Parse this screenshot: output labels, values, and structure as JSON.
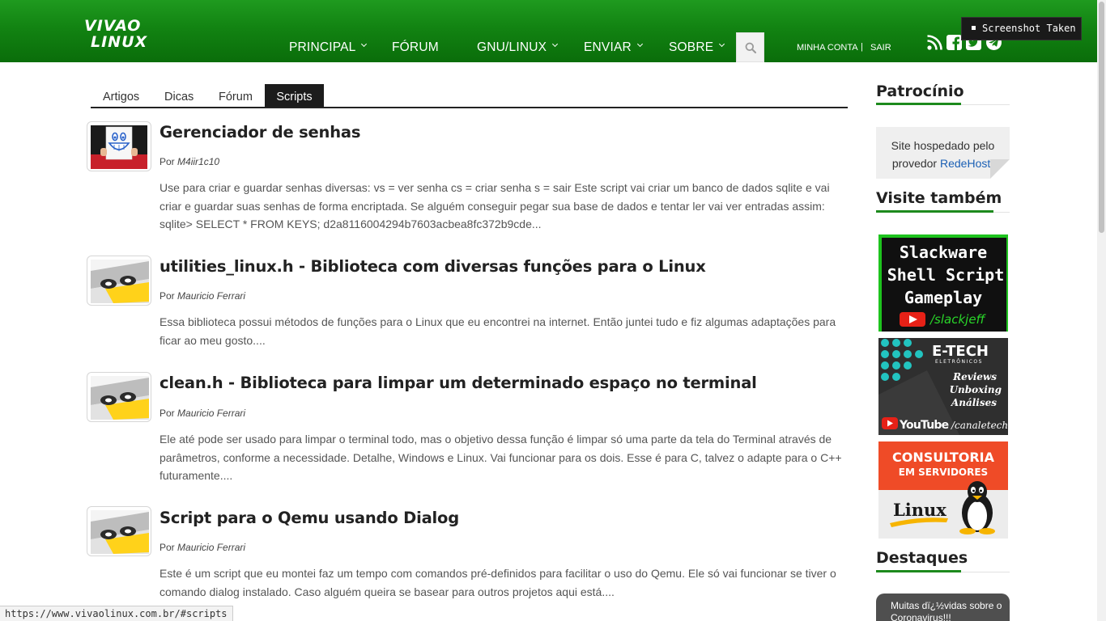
{
  "header": {
    "logo_text_top": "VIVAO",
    "logo_text_bottom": "LINUX",
    "nav": [
      {
        "label": "PRINCIPAL"
      },
      {
        "label": "FÓRUM"
      },
      {
        "label": "GNU/LINUX"
      },
      {
        "label": "ENVIAR"
      },
      {
        "label": "SOBRE"
      }
    ],
    "account_label": "MINHA CONTA",
    "account_sep": "|",
    "logout_label": "SAIR",
    "social_icons": [
      "rss-icon",
      "facebook-icon",
      "twitter-icon",
      "telegram-icon"
    ]
  },
  "toast": {
    "label": "Screenshot Taken"
  },
  "tabs": [
    {
      "label": "Artigos"
    },
    {
      "label": "Dicas"
    },
    {
      "label": "Fórum"
    },
    {
      "label": "Scripts",
      "active": true
    }
  ],
  "articles": [
    {
      "title": "Gerenciador de senhas",
      "by": "Por",
      "author": "M4iir1c10",
      "desc": "Use para criar e guardar senhas diversas: vs = ver senha cs = criar senha s = sair Este script vai criar um banco de dados sqlite e vai criar e guardar suas senhas de forma encriptada. Se alguém conseguir pegar sua base de dados e tentar ler vai ver entradas assim: sqlite> SELECT * FROM KEYS; d2a8116004294b7603acbea8fc372b9cde..."
    },
    {
      "title": "utilities_linux.h - Biblioteca com diversas funções para o Linux",
      "by": "Por",
      "author": "Mauricio Ferrari",
      "desc": "Essa biblioteca possui métodos de funções para o Linux que eu encontrei na internet. Então juntei tudo e fiz algumas adaptações para ficar ao meu gosto...."
    },
    {
      "title": "clean.h - Biblioteca para limpar um determinado espaço no terminal",
      "by": "Por",
      "author": "Mauricio Ferrari",
      "desc": "Ele até pode ser usado para limpar o terminal todo, mas o objetivo dessa função é limpar só uma parte da tela do Terminal através de parâmetros, conforme a necessidade. Detalhe, Windows e Linux. Vai funcionar para os dois. Esse é para C, talvez o adapte para o C++ futuramente...."
    },
    {
      "title": "Script para o Qemu usando Dialog",
      "by": "Por",
      "author": "Mauricio Ferrari",
      "desc": "Este é um script que eu montei faz um tempo com comandos pré-definidos para facilitar o uso do Qemu. Ele só vai funcionar se tiver o comando dialog instalado. Caso alguém queira se basear para outros projetos aqui está...."
    }
  ],
  "sidebar": {
    "sponsor_heading": "Patrocínio",
    "sponsor_text": "Site hospedado pelo provedor",
    "sponsor_link": "RedeHost",
    "sponsor_end": ".",
    "visit_heading": "Visite também",
    "ads": [
      {
        "line1": "Slackware",
        "line2": "Shell Script",
        "line3": "Gameplay",
        "channel": "/slackjeff"
      },
      {
        "brand": "E-TECH",
        "sub": "ELETRÔNICOS",
        "l1": "Reviews",
        "l2": "Unboxing",
        "l3": "Análises",
        "yt": "YouTube",
        "channel": "/canaletech"
      },
      {
        "l1": "CONSULTORIA",
        "l2": "EM SERVIDORES",
        "l3": "Linux"
      }
    ],
    "highlights_heading": "Destaques",
    "highlight_preview": "Muitas dï¿½vidas sobre o Coronavirus!!!"
  },
  "status_url": "https://www.vivaolinux.com.br/#scripts",
  "colors": {
    "header_green": "#128312",
    "accent_green": "#1d8a1d",
    "link_blue": "#1a5fb4",
    "tab_active": "#1c1c1c"
  }
}
